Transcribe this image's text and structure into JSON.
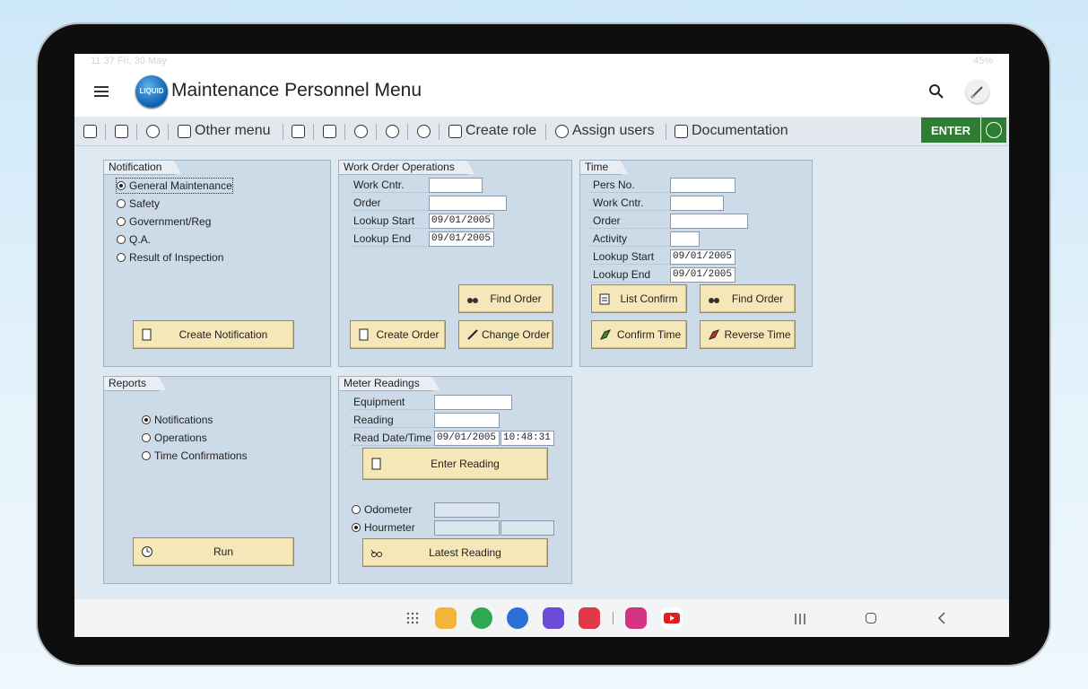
{
  "status": {
    "time": "11:37  Fri, 30 May",
    "right": "45%"
  },
  "app": {
    "logo_text": "LIQUID",
    "title": "Maintenance Personnel Menu"
  },
  "toolbar": {
    "other_menu": "Other menu",
    "create_role": "Create role",
    "assign_users": "Assign users",
    "documentation": "Documentation",
    "enter": "ENTER"
  },
  "notification": {
    "title": "Notification",
    "options": [
      "General Maintenance",
      "Safety",
      "Government/Reg",
      "Q.A.",
      "Result of Inspection"
    ],
    "create_button": "Create Notification"
  },
  "work_order": {
    "title": "Work Order Operations",
    "labels": [
      "Work Cntr.",
      "Order",
      "Lookup Start",
      "Lookup End"
    ],
    "lookup_start": "09/01/2005",
    "lookup_end": "09/01/2005",
    "find_order": "Find Order",
    "create_order": "Create Order",
    "change_order": "Change Order"
  },
  "time": {
    "title": "Time",
    "labels": [
      "Pers No.",
      "Work Cntr.",
      "Order",
      "Activity",
      "Lookup Start",
      "Lookup End"
    ],
    "lookup_start": "09/01/2005",
    "lookup_end": "09/01/2005",
    "list_confirm": "List Confirm",
    "find_order": "Find Order",
    "confirm_time": "Confirm Time",
    "reverse_time": "Reverse Time"
  },
  "reports": {
    "title": "Reports",
    "options": [
      "Notifications",
      "Operations",
      "Time Confirmations"
    ],
    "run": "Run"
  },
  "meter": {
    "title": "Meter Readings",
    "labels": [
      "Equipment",
      "Reading",
      "Read Date/Time"
    ],
    "read_date": "09/01/2005",
    "read_time": "10:48:31",
    "enter_reading": "Enter Reading",
    "odometer": "Odometer",
    "hourmeter": "Hourmeter",
    "latest_reading": "Latest Reading"
  },
  "colors": {
    "accent": "#2e7d32",
    "button": "#f6e7b8",
    "group": "#cddbe8"
  }
}
